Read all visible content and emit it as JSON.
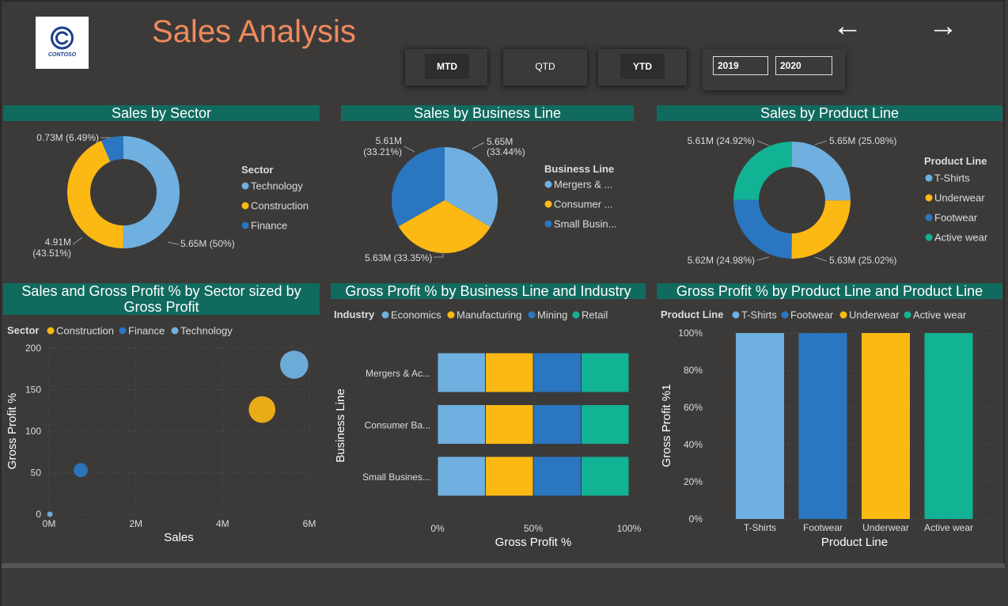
{
  "header": {
    "title": "Sales Analysis",
    "logo_text": "CONTOSO",
    "back_arrow": "←",
    "forward_arrow": "→"
  },
  "period_buttons": [
    "MTD",
    "QTD",
    "YTD"
  ],
  "years": [
    "2019",
    "2020"
  ],
  "colors": {
    "light_blue": "#6fb0e0",
    "yellow": "#fdb913",
    "dark_blue": "#2b76c0",
    "teal": "#12b294",
    "header_bg": "#116a5e",
    "title": "#f08a5d"
  },
  "charts": {
    "sector": {
      "title": "Sales by Sector",
      "legend_title": "Sector",
      "slices": [
        {
          "name": "Technology",
          "value": 5.65,
          "label": "5.65M (50%)"
        },
        {
          "name": "Construction",
          "value": 4.91,
          "label_l1": "4.91M",
          "label_l2": "(43.51%)"
        },
        {
          "name": "Finance",
          "value": 0.73,
          "label": "0.73M (6.49%)"
        }
      ]
    },
    "business": {
      "title": "Sales by Business Line",
      "legend_title": "Business Line",
      "legend": [
        "Mergers & ...",
        "Consumer ...",
        "Small Busin..."
      ],
      "slices": [
        {
          "name": "Mergers & Acquisitions",
          "value": 5.65,
          "label_l1": "5.65M",
          "label_l2": "(33.44%)"
        },
        {
          "name": "Consumer Banking",
          "value": 5.63,
          "label": "5.63M (33.35%)"
        },
        {
          "name": "Small Business",
          "value": 5.61,
          "label_l1": "5.61M",
          "label_l2": "(33.21%)"
        }
      ]
    },
    "product": {
      "title": "Sales by Product Line",
      "legend_title": "Product Line",
      "legend": [
        "T-Shirts",
        "Underwear",
        "Footwear",
        "Active wear"
      ],
      "slices": [
        {
          "name": "T-Shirts",
          "value": 5.65,
          "label": "5.65M (25.08%)"
        },
        {
          "name": "Underwear",
          "value": 5.63,
          "label": "5.63M (25.02%)"
        },
        {
          "name": "Footwear",
          "value": 5.62,
          "label": "5.62M (24.98%)"
        },
        {
          "name": "Active wear",
          "value": 5.61,
          "label": "5.61M (24.92%)"
        }
      ]
    },
    "scatter": {
      "title_l1": "Sales and Gross Profit % by Sector sized by",
      "title_l2": "Gross Profit",
      "legend_title": "Sector",
      "legend": [
        "Construction",
        "Finance",
        "Technology"
      ],
      "xlabel": "Sales",
      "ylabel": "Gross Profit %",
      "xticks": [
        "0M",
        "2M",
        "4M",
        "6M"
      ],
      "yticks": [
        "0",
        "50",
        "100",
        "150",
        "200"
      ],
      "xlim": [
        0,
        6
      ],
      "ylim": [
        0,
        200
      ],
      "points": [
        {
          "sector": "Technology",
          "x": 5.65,
          "y": 180,
          "size": 5.65
        },
        {
          "sector": "Construction",
          "x": 4.91,
          "y": 126,
          "size": 4.91
        },
        {
          "sector": "Finance",
          "x": 0.73,
          "y": 53,
          "size": 0.73
        },
        {
          "sector": "Technology",
          "x": 0.02,
          "y": 0,
          "size": 0.2
        }
      ]
    },
    "stacked": {
      "title": "Gross Profit % by Business Line and Industry",
      "legend_title": "Industry",
      "legend": [
        "Economics",
        "Manufacturing",
        "Mining",
        "Retail"
      ],
      "ylabel": "Business Line",
      "xlabel": "Gross Profit %",
      "xticks": [
        "0%",
        "50%",
        "100%"
      ],
      "categories": [
        "Mergers & Ac...",
        "Consumer Ba...",
        "Small Busines..."
      ],
      "series": [
        {
          "name": "Economics",
          "values": [
            25,
            25,
            25
          ]
        },
        {
          "name": "Manufacturing",
          "values": [
            25,
            25,
            25
          ]
        },
        {
          "name": "Mining",
          "values": [
            25,
            25,
            25
          ]
        },
        {
          "name": "Retail",
          "values": [
            25,
            25,
            25
          ]
        }
      ]
    },
    "column": {
      "title": "Gross Profit % by Product Line and Product Line",
      "legend_title": "Product Line",
      "legend": [
        "T-Shirts",
        "Footwear",
        "Underwear",
        "Active wear"
      ],
      "xlabel": "Product Line",
      "ylabel": "Gross Profit %1",
      "yticks": [
        "0%",
        "20%",
        "40%",
        "60%",
        "80%",
        "100%"
      ],
      "categories": [
        "T-Shirts",
        "Footwear",
        "Underwear",
        "Active wear"
      ],
      "values": [
        100,
        100,
        100,
        100
      ]
    }
  }
}
